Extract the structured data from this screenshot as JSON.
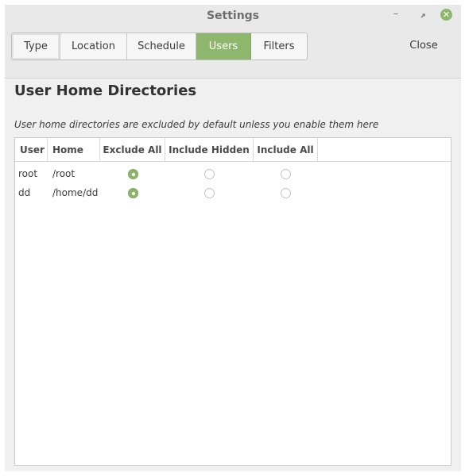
{
  "window": {
    "title": "Settings",
    "close_label": "Close"
  },
  "tabs": [
    {
      "label": "Type",
      "active": false
    },
    {
      "label": "Location",
      "active": false
    },
    {
      "label": "Schedule",
      "active": false
    },
    {
      "label": "Users",
      "active": true
    },
    {
      "label": "Filters",
      "active": false
    }
  ],
  "page": {
    "heading": "User Home Directories",
    "subtitle": "User home directories are excluded by default unless you enable them here"
  },
  "table": {
    "columns": [
      "User",
      "Home",
      "Exclude All",
      "Include Hidden",
      "Include All"
    ],
    "rows": [
      {
        "user": "root",
        "home": "/root",
        "selection": "Exclude All"
      },
      {
        "user": "dd",
        "home": "/home/dd",
        "selection": "Exclude All"
      }
    ]
  },
  "colors": {
    "accent": "#8fb66d",
    "header_bg": "#e9e9e9",
    "window_bg": "#f0f0f0"
  },
  "icons": {
    "minimize": "minimize-icon",
    "maximize": "maximize-icon",
    "close": "close-icon"
  }
}
